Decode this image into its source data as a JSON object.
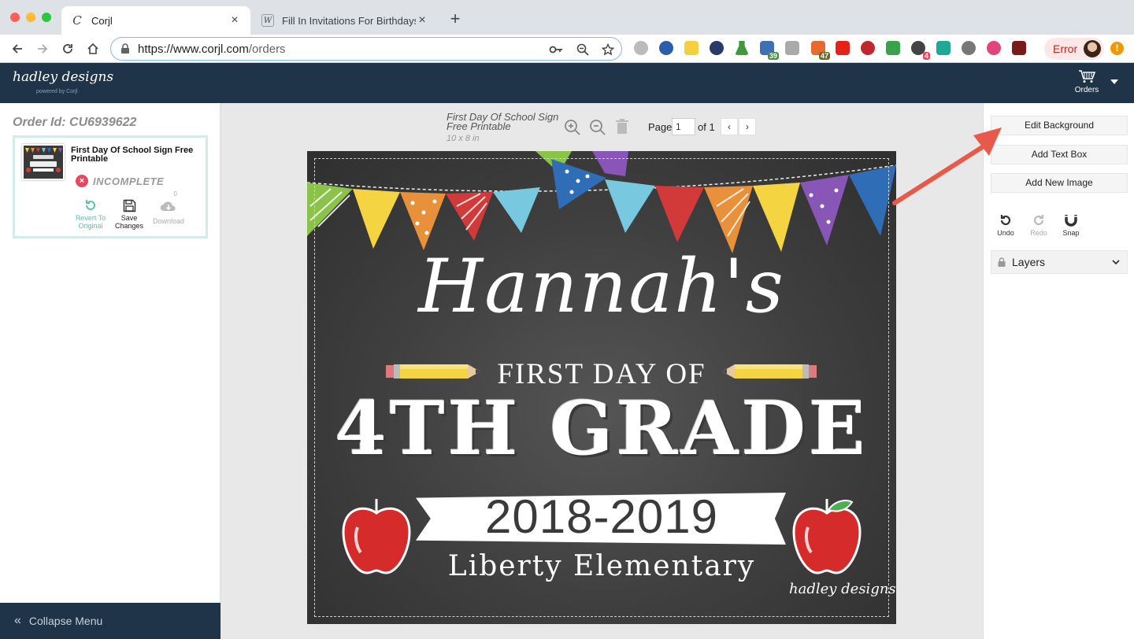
{
  "browser": {
    "tabs": [
      {
        "title": "Corjl",
        "active": true
      },
      {
        "title": "Fill In Invitations For Birthdays, W",
        "active": false
      }
    ],
    "url": {
      "host": "https://www.corjl.com",
      "path": "/orders"
    },
    "extension_badges": {
      "ext_a": "39",
      "ext_b": "47",
      "ext_c": "4"
    },
    "profile_status": "Error",
    "warning_symbol": "!"
  },
  "app": {
    "logo": "hadley designs",
    "logo_sub": "powered by Corjl",
    "orders_label": "Orders"
  },
  "sidebar": {
    "order_id": "Order Id: CU6939622",
    "card": {
      "title": "First Day Of School Sign Free Printable",
      "status": "INCOMPLETE",
      "download_count": "0",
      "actions": {
        "revert": "Revert To Original",
        "save": "Save Changes",
        "download": "Download"
      }
    },
    "collapse_label": "Collapse Menu"
  },
  "editor": {
    "doc_title": "First Day Of School Sign Free Printable",
    "doc_size": "10 x 8 in",
    "page_label": "Page",
    "page_value": "1",
    "page_of": "of 1"
  },
  "design": {
    "name": "Hannah's",
    "first_day": "FIRST DAY OF",
    "grade": "4TH GRADE",
    "year": "2018-2019",
    "school": "Liberty Elementary",
    "logo": "hadley designs"
  },
  "right_panel": {
    "edit_background": "Edit Background",
    "add_text_box": "Add Text Box",
    "add_new_image": "Add New Image",
    "undo": "Undo",
    "redo": "Redo",
    "snap": "Snap",
    "layers": "Layers"
  },
  "colors": {
    "header_navy": "#1f3449",
    "card_border": "#d2ede8",
    "teal_action": "#5bc4b0",
    "arrow": "#e8594a",
    "status_red": "#e44a5f"
  }
}
